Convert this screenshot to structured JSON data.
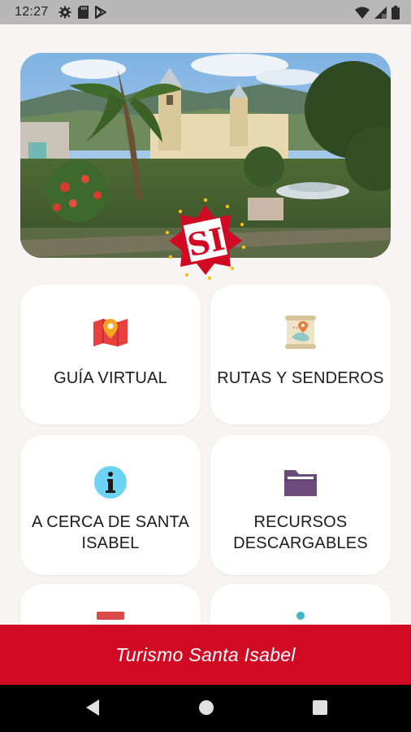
{
  "status_bar": {
    "time": "12:27",
    "left_icons": [
      "gear-icon",
      "sd-card-icon",
      "play-store-icon"
    ],
    "right_icons": [
      "wifi-icon",
      "signal-icon",
      "battery-icon"
    ]
  },
  "hero": {
    "image": "plaza-photo",
    "logo_text": "SI",
    "colors": {
      "logo_red": "#d10a24",
      "logo_star": "#f4c20d"
    }
  },
  "menu": {
    "items": [
      {
        "label": "GUÍA VIRTUAL",
        "icon": "map-pin-icon"
      },
      {
        "label": "RUTAS Y SENDEROS",
        "icon": "scroll-map-icon"
      },
      {
        "label": "A CERCA DE SANTA ISABEL",
        "icon": "info-icon"
      },
      {
        "label": "RECURSOS DESCARGABLES",
        "icon": "folder-icon"
      }
    ]
  },
  "footer": {
    "title": "Turismo Santa Isabel",
    "color": "#d10a24"
  },
  "nav": {
    "buttons": [
      "back-icon",
      "home-icon",
      "recents-icon"
    ]
  }
}
